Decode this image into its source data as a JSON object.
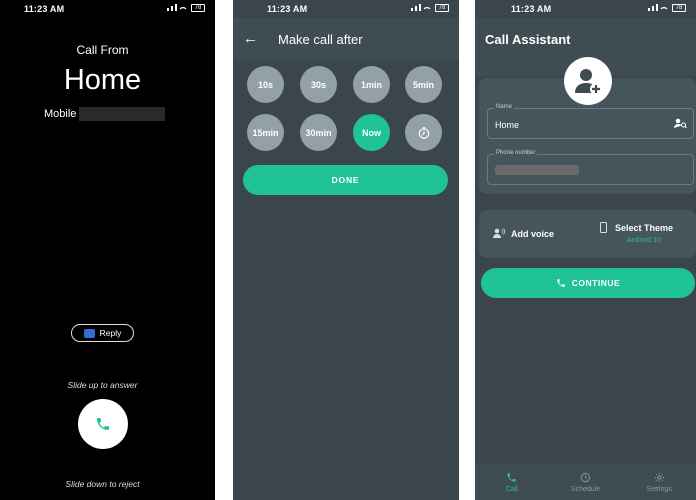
{
  "status_bar": {
    "time": "11:23 AM",
    "battery": "78"
  },
  "call_screen": {
    "call_from": "Call From",
    "caller_name": "Home",
    "number_label": "Mobile",
    "reply_label": "Reply",
    "slide_up_hint": "Slide up to answer",
    "slide_down_hint": "Slide down to reject"
  },
  "schedule_screen": {
    "title": "Make call after",
    "options": [
      "10s",
      "30s",
      "1min",
      "5min",
      "15min",
      "30min",
      "Now"
    ],
    "selected": "Now",
    "done_label": "DONE"
  },
  "assistant_screen": {
    "title": "Call Assistant",
    "name_label": "Name",
    "name_value": "Home",
    "phone_label": "Phone number",
    "add_voice_label": "Add voice",
    "select_theme_label": "Select Theme",
    "theme_value": "Android 10",
    "continue_label": "CONTINUE",
    "nav": [
      {
        "label": "Call",
        "icon": "phone-icon",
        "active": true
      },
      {
        "label": "Schedule",
        "icon": "schedule-icon",
        "active": false
      },
      {
        "label": "Settings",
        "icon": "gear-icon",
        "active": false
      }
    ]
  },
  "colors": {
    "accent": "#20c298",
    "panel_bg": "#3a464b",
    "call_bg": "#000000"
  }
}
